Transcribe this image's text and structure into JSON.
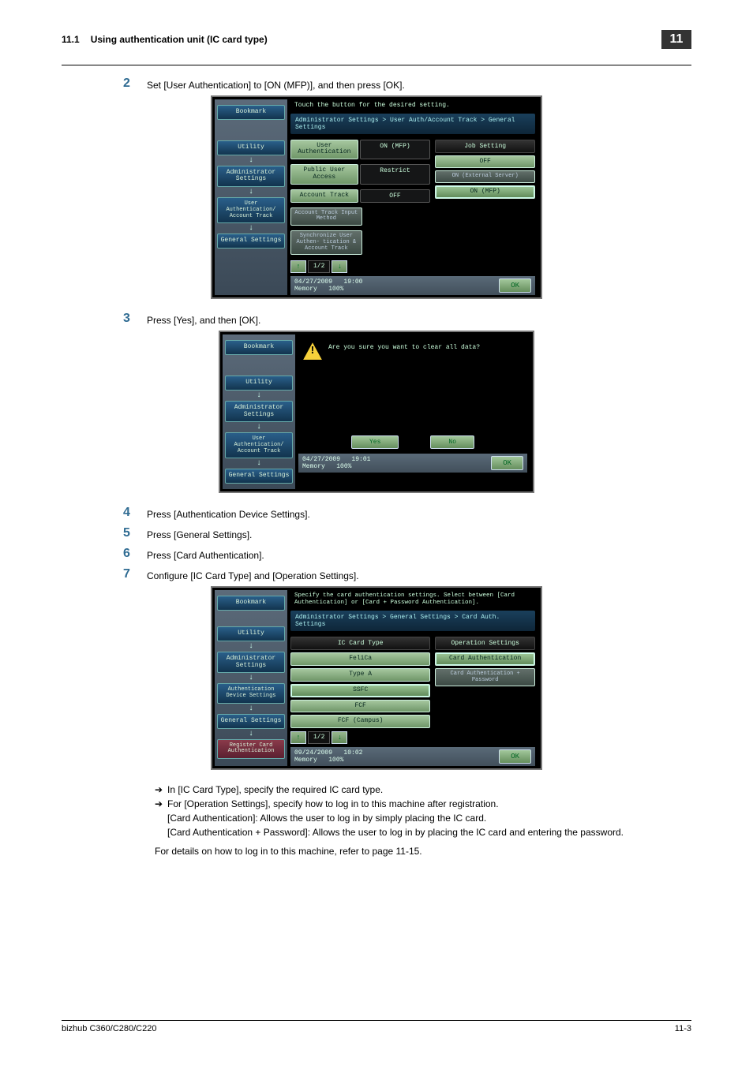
{
  "header": {
    "section_number": "11.1",
    "section_title": "Using authentication unit (IC card type)",
    "chapter_badge": "11"
  },
  "steps": {
    "s2": {
      "num": "2",
      "text": "Set [User Authentication] to [ON (MFP)], and then press [OK]."
    },
    "s3": {
      "num": "3",
      "text": "Press [Yes], and then [OK]."
    },
    "s4": {
      "num": "4",
      "text": "Press [Authentication Device Settings]."
    },
    "s5": {
      "num": "5",
      "text": "Press [General Settings]."
    },
    "s6": {
      "num": "6",
      "text": "Press [Card Authentication]."
    },
    "s7": {
      "num": "7",
      "text": "Configure [IC Card Type] and [Operation Settings]."
    }
  },
  "screen1": {
    "instruction": "Touch the button for the desired setting.",
    "breadcrumb": "Administrator Settings > User Auth/Account Track  > General Settings",
    "side": {
      "bookmark": "Bookmark",
      "utility": "Utility",
      "admin": "Administrator Settings",
      "userauth": "User Authentication/ Account Track",
      "general": "General Settings"
    },
    "rows": {
      "user_auth": "User Authentication",
      "user_auth_val": "ON (MFP)",
      "pub_access": "Public User Access",
      "pub_access_val": "Restrict",
      "acct_track": "Account Track",
      "acct_track_val": "OFF",
      "acct_input": "Account Track Input Method",
      "sync": "Synchronize User Authen- tication & Account Track"
    },
    "right": {
      "header": "Job Setting",
      "off": "OFF",
      "ext": "ON (External Server)",
      "mfp": "ON (MFP)"
    },
    "pager": {
      "up": "↑",
      "page": "1/2",
      "down": "↓"
    },
    "footer": {
      "date": "04/27/2009",
      "time": "19:00",
      "mem_lbl": "Memory",
      "mem_val": "100%",
      "ok": "OK"
    }
  },
  "screen2": {
    "msg": "Are you sure you want to clear all data?",
    "side": {
      "bookmark": "Bookmark",
      "utility": "Utility",
      "admin": "Administrator Settings",
      "userauth": "User Authentication/ Account Track",
      "general": "General Settings"
    },
    "yes": "Yes",
    "no": "No",
    "footer": {
      "date": "04/27/2009",
      "time": "19:01",
      "mem_lbl": "Memory",
      "mem_val": "100%",
      "ok": "OK"
    }
  },
  "screen3": {
    "instruction": "Specify the card authentication settings. Select between [Card Authentication] or [Card + Password Authentication].",
    "breadcrumb": "Administrator Settings > General Settings > Card Auth. Settings",
    "side": {
      "bookmark": "Bookmark",
      "utility": "Utility",
      "admin": "Administrator Settings",
      "authdev": "Authentication Device Settings",
      "general": "General Settings",
      "register": "Register Card Authentication"
    },
    "left_header": "IC Card Type",
    "right_header": "Operation Settings",
    "cardtypes": {
      "felica": "FeliCa",
      "typea": "Type A",
      "ssfc": "SSFC",
      "fcf": "FCF",
      "fcfc": "FCF (Campus)"
    },
    "ops": {
      "card": "Card Authentication",
      "cardpw": "Card Authentication + Password"
    },
    "pager": {
      "up": "↑",
      "page": "1/2",
      "down": "↓"
    },
    "footer": {
      "date": "09/24/2009",
      "time": "10:02",
      "mem_lbl": "Memory",
      "mem_val": "100%",
      "ok": "OK"
    }
  },
  "notes": {
    "b1": "In [IC Card Type], specify the required IC card type.",
    "b2": "For [Operation Settings], specify how to log in to this machine after registration.",
    "b2a": "[Card Authentication]: Allows the user to log in by simply placing the IC card.",
    "b2b": "[Card Authentication + Password]: Allows the user to log in by placing the IC card and entering the password.",
    "p1": "For details on how to log in to this machine, refer to page 11-15."
  },
  "footer": {
    "product": "bizhub C360/C280/C220",
    "page": "11-3"
  }
}
